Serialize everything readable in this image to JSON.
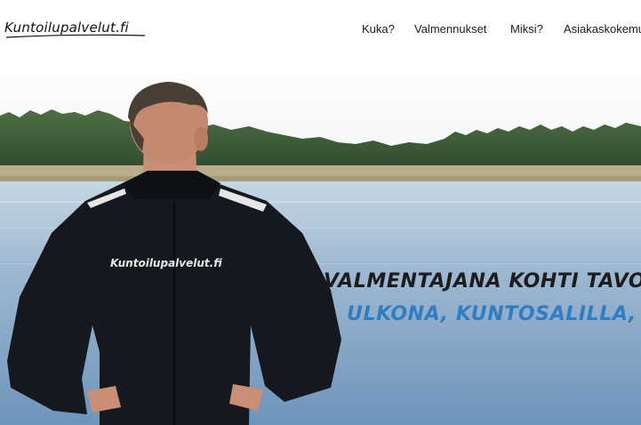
{
  "header": {
    "logo": "Kuntoilupalvelut.fi",
    "nav": [
      {
        "label": "Kuka?"
      },
      {
        "label": "Valmennukset"
      },
      {
        "label": "Miksi?"
      },
      {
        "label": "Asiakaskokemu"
      }
    ]
  },
  "hero": {
    "headline": "VALMENTAJANA KOHTI TAVOI",
    "subheadline": "ULKONA, KUNTOSALILLA, KO",
    "jacket_logo": "Kuntoilupalvelut.fi"
  },
  "colors": {
    "accent": "#2f7ec2",
    "headline": "#1d1d1d"
  },
  "icons": [
    "logo-swoosh-icon"
  ]
}
